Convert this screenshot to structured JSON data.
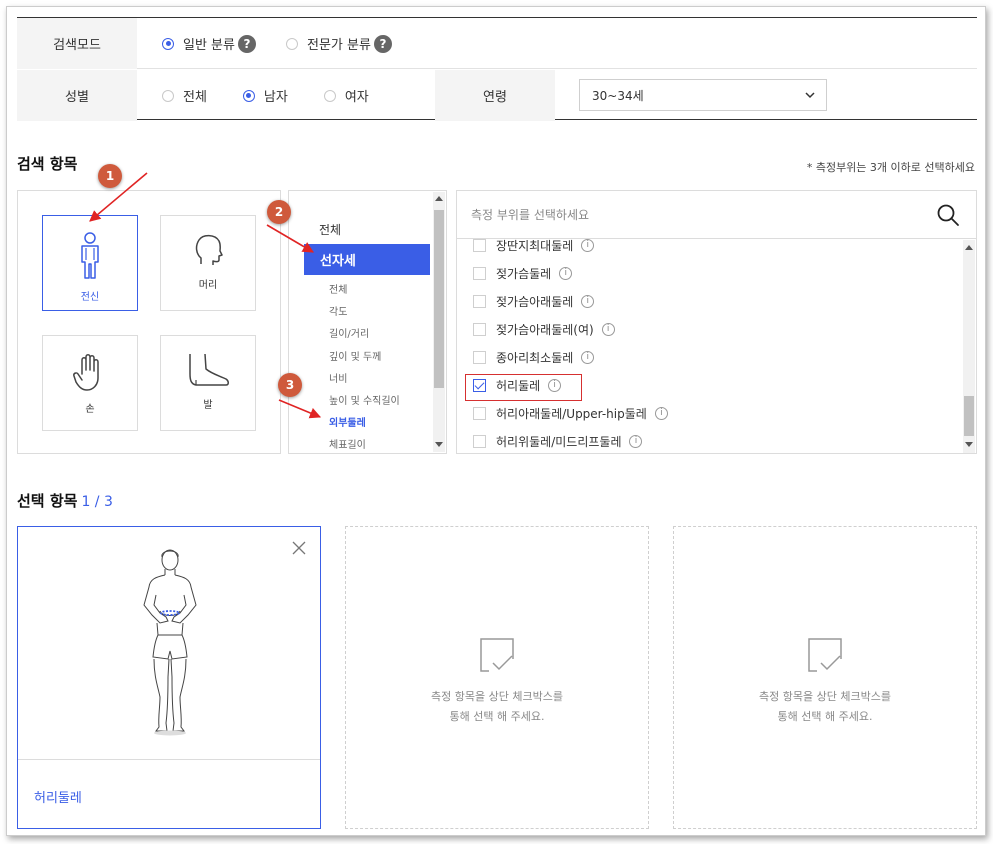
{
  "filters": {
    "search_mode_label": "검색모드",
    "search_mode_options": [
      {
        "label": "일반 분류",
        "selected": true
      },
      {
        "label": "전문가 분류",
        "selected": false
      }
    ],
    "gender_label": "성별",
    "gender_options": [
      {
        "label": "전체",
        "selected": false
      },
      {
        "label": "남자",
        "selected": true
      },
      {
        "label": "여자",
        "selected": false
      }
    ],
    "age_label": "연령",
    "age_value": "30~34세",
    "help_icon": "?"
  },
  "search_items": {
    "title": "검색 항목",
    "note": "* 측정부위는 3개 이하로 선택하세요",
    "body_parts": [
      {
        "label": "전신",
        "icon": "full-body-icon",
        "active": true
      },
      {
        "label": "머리",
        "icon": "head-icon",
        "active": false
      },
      {
        "label": "손",
        "icon": "hand-icon",
        "active": false
      },
      {
        "label": "발",
        "icon": "foot-icon",
        "active": false
      }
    ],
    "categories": {
      "all_label": "전체",
      "active_label": "선자세",
      "sub_items": [
        "전체",
        "각도",
        "길이/거리",
        "깊이 및 두께",
        "너비",
        "높이 및 수직길이",
        "외부둘레",
        "체표길이"
      ],
      "selected_sub": "외부둘레"
    },
    "measurements": {
      "placeholder": "측정 부위를 선택하세요",
      "items": [
        {
          "label": "장딴지최대둘레",
          "checked": false
        },
        {
          "label": "젖가슴둘레",
          "checked": false
        },
        {
          "label": "젖가슴아래둘레",
          "checked": false
        },
        {
          "label": "젖가슴아래둘레(여)",
          "checked": false
        },
        {
          "label": "종아리최소둘레",
          "checked": false
        },
        {
          "label": "허리둘레",
          "checked": true
        },
        {
          "label": "허리아래둘레/Upper-hip둘레",
          "checked": false
        },
        {
          "label": "허리위둘레/미드리프둘레",
          "checked": false
        }
      ],
      "info_glyph": "i"
    }
  },
  "annotations": [
    "1",
    "2",
    "3"
  ],
  "selected": {
    "title": "선택 항목",
    "count": "1 / 3",
    "card_label": "허리둘레",
    "placeholder_line1": "측정 항목을 상단 체크박스를",
    "placeholder_line2": "통해 선택 해 주세요."
  },
  "colors": {
    "accent": "#3a5ee6",
    "annotation": "#cf5a3c",
    "highlight": "#d63030"
  }
}
